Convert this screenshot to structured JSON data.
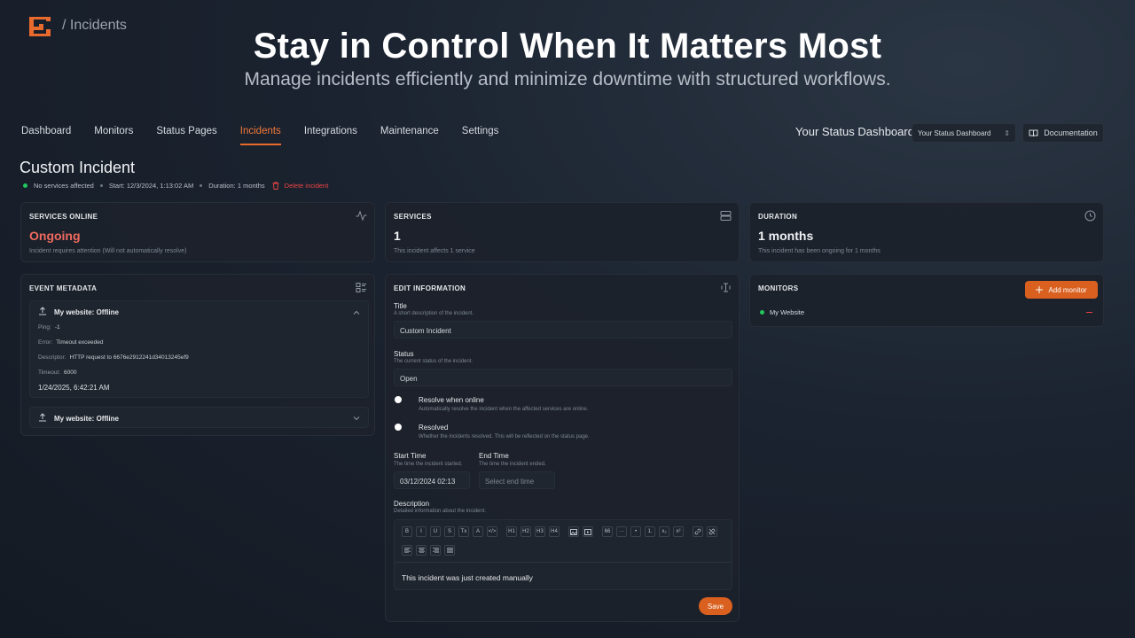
{
  "colors": {
    "accent": "#e86a2c",
    "danger": "#ef4444",
    "success": "#22c55e"
  },
  "header": {
    "breadcrumb": "/ Incidents",
    "hero_title": "Stay in Control When It Matters Most",
    "hero_subtitle": "Manage incidents efficiently and minimize downtime with structured workflows."
  },
  "nav": {
    "items": [
      {
        "label": "Dashboard"
      },
      {
        "label": "Monitors"
      },
      {
        "label": "Status Pages"
      },
      {
        "label": "Incidents",
        "active": true
      },
      {
        "label": "Integrations"
      },
      {
        "label": "Maintenance"
      },
      {
        "label": "Settings"
      }
    ],
    "status_label": "Your Status Dashboard",
    "status_select_value": "Your Status Dashboard",
    "docs_label": "Documentation"
  },
  "incident": {
    "title": "Custom Incident",
    "services_affected": "No services affected",
    "start": "Start: 12/3/2024, 1:13:02 AM",
    "duration": "Duration: 1 months",
    "delete_label": "Delete incident"
  },
  "cards": {
    "services_online": {
      "header": "SERVICES ONLINE",
      "value": "Ongoing",
      "note": "Incident requires attention (Will not automatically resolve)"
    },
    "services": {
      "header": "SERVICES",
      "value": "1",
      "note": "This incident affects 1 service"
    },
    "duration": {
      "header": "DURATION",
      "value": "1 months",
      "note": "This incident has been ongoing for 1 months"
    }
  },
  "event_metadata": {
    "header": "EVENT METADATA",
    "events": [
      {
        "title": "My website: Offline",
        "ping_label": "Ping:",
        "ping": "-1",
        "error_label": "Error:",
        "error": "Timeout exceeded",
        "descriptor_label": "Descriptor:",
        "descriptor": "HTTP request to 6676e2912241d34013245ef9",
        "timeout_label": "Timeout:",
        "timeout": "6000",
        "time": "1/24/2025, 6:42:21 AM"
      },
      {
        "title": "My website: Offline"
      }
    ]
  },
  "edit": {
    "header": "EDIT INFORMATION",
    "title_label": "Title",
    "title_hint": "A short description of the incident.",
    "title_value": "Custom Incident",
    "status_label": "Status",
    "status_hint": "The current status of the incident.",
    "status_value": "Open",
    "resolve_online_label": "Resolve when online",
    "resolve_online_hint": "Automatically resolve the incident when the affected services are online.",
    "resolved_label": "Resolved",
    "resolved_hint": "Whether the incidents resolved. This will be reflected on the status page.",
    "start_label": "Start Time",
    "start_hint": "The time the incident started.",
    "start_value": "03/12/2024 02:13",
    "end_label": "End Time",
    "end_hint": "The time the incident ended.",
    "end_placeholder": "Select end time",
    "desc_label": "Description",
    "desc_hint": "Detailed information about the incident.",
    "desc_text": "This incident was just created manually",
    "save_label": "Save",
    "toolbar_row1": [
      "B",
      "I",
      "U",
      "S",
      "Tx",
      "A",
      "</>",
      "H1",
      "H2",
      "H3",
      "H4",
      "img",
      "vid",
      "66",
      "···",
      "•",
      "1.",
      "x₂",
      "x²",
      "link",
      "unlink"
    ],
    "toolbar_row2": [
      "≡L",
      "≡C",
      "≡R",
      "≡J"
    ]
  },
  "monitors": {
    "header": "MONITORS",
    "add_label": "Add monitor",
    "items": [
      {
        "name": "My Website",
        "status_color": "#22c55e"
      }
    ]
  }
}
